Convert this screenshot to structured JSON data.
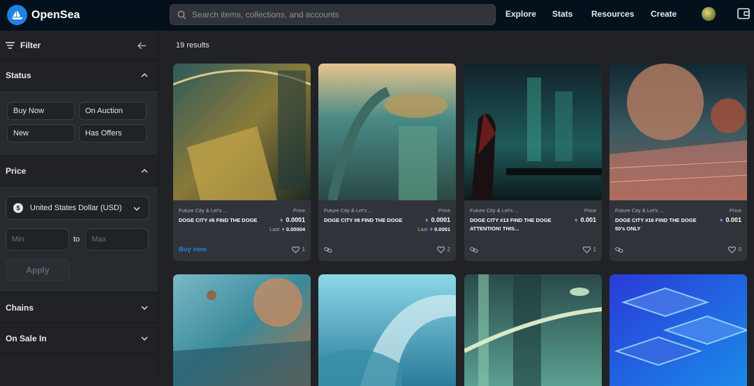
{
  "header": {
    "brand": "OpenSea",
    "search_placeholder": "Search items, collections, and accounts",
    "nav": [
      "Explore",
      "Stats",
      "Resources",
      "Create"
    ]
  },
  "sidebar": {
    "title": "Filter",
    "status": {
      "label": "Status",
      "options": [
        "Buy Now",
        "On Auction",
        "New",
        "Has Offers"
      ]
    },
    "price": {
      "label": "Price",
      "currency": "United States Dollar (USD)",
      "min_placeholder": "Min",
      "to": "to",
      "max_placeholder": "Max",
      "apply": "Apply"
    },
    "chains": "Chains",
    "on_sale_in": "On Sale In"
  },
  "main": {
    "results": "19 results",
    "cards": [
      {
        "collection": "Future City & Let's ...",
        "name": "DOGE CITY #6 FIND THE DOGE",
        "price_label": "Price",
        "price": "0.0001",
        "last_label": "Last",
        "last": "0.00004",
        "action": "Buy now",
        "likes": "1"
      },
      {
        "collection": "Future City & Let's ...",
        "name": "DOGE CITY #8 FIND THE DOGE",
        "price_label": "Price",
        "price": "0.0001",
        "last_label": "Last",
        "last": "0.0001",
        "action": "",
        "likes": "2"
      },
      {
        "collection": "Future City & Let's ...",
        "name": "DOGE CITY #13 FIND THE DOGE ATTENTION! THIS...",
        "price_label": "Price",
        "price": "0.001",
        "last_label": "",
        "last": "",
        "action": "",
        "likes": "1"
      },
      {
        "collection": "Future City & Let's ...",
        "name": "DOGE CITY #16 FIND THE DOGE 50's ONLY",
        "price_label": "Price",
        "price": "0.001",
        "last_label": "",
        "last": "",
        "action": "",
        "likes": "0"
      }
    ]
  },
  "colors": {
    "background": "#202225",
    "header": "#04111d",
    "card": "#303339",
    "accent": "#2081e2",
    "eth": "#8a7cf0"
  }
}
